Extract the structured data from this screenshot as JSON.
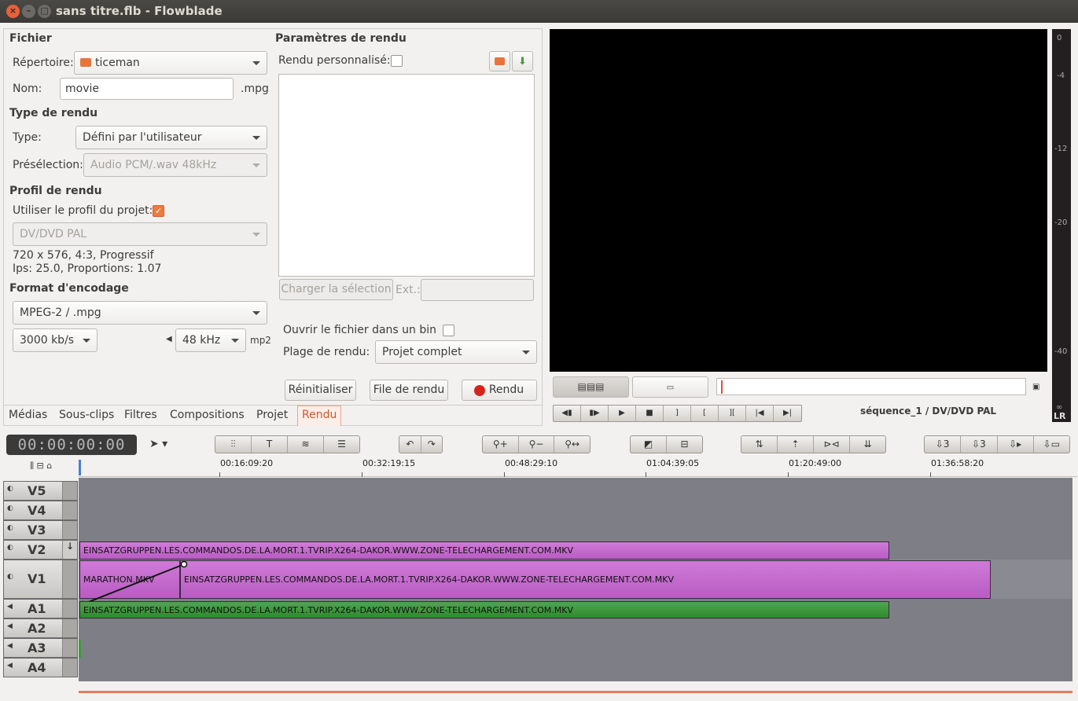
{
  "window": {
    "title": "sans titre.flb - Flowblade"
  },
  "file": {
    "heading": "Fichier",
    "dir_label": "Répertoire:",
    "dir_value": "ticeman",
    "name_label": "Nom:",
    "name_value": "movie",
    "ext": ".mpg"
  },
  "render_type": {
    "heading": "Type de rendu",
    "type_label": "Type:",
    "type_value": "Défini par l'utilisateur",
    "preset_label": "Présélection:",
    "preset_value": "Audio PCM/.wav 48kHz"
  },
  "profile": {
    "heading": "Profil de rendu",
    "use_project_label": "Utiliser le profil du projet:",
    "value": "DV/DVD PAL",
    "info1": "720 x 576, 4:3, Progressif",
    "info2": "Ips: 25.0, Proportions: 1.07"
  },
  "encoding": {
    "heading": "Format d'encodage",
    "format_value": "MPEG-2 / .mpg",
    "bitrate": "3000 kb/s",
    "audio_rate": "48 kHz",
    "audio_codec": "mp2"
  },
  "render_params": {
    "heading": "Paramètres de rendu",
    "custom_label": "Rendu personnalisé:",
    "load_selection": "Charger la sélection",
    "ext_label": "Ext.:",
    "open_in_bin": "Ouvrir le fichier dans un bin",
    "range_label": "Plage de rendu:",
    "range_value": "Projet complet",
    "reset": "Réinitialiser",
    "queue": "File de rendu",
    "render": "Rendu"
  },
  "tabs": [
    {
      "label": "Médias"
    },
    {
      "label": "Sous-clips"
    },
    {
      "label": "Filtres"
    },
    {
      "label": "Compositions"
    },
    {
      "label": "Projet"
    },
    {
      "label": "Rendu"
    }
  ],
  "viewer": {
    "sequence_info": "séquence_1 / DV/DVD PAL"
  },
  "meter": {
    "labels": [
      "0",
      "-4",
      "-12",
      "-20",
      "-40",
      "∞"
    ],
    "lr": "LR"
  },
  "timeline": {
    "timecode": "00:00:00:00",
    "ruler": [
      "00:16:09:20",
      "00:32:19:15",
      "00:48:29:10",
      "01:04:39:05",
      "01:20:49:00",
      "01:36:58:20"
    ],
    "tracks": [
      {
        "name": "V5"
      },
      {
        "name": "V4"
      },
      {
        "name": "V3"
      },
      {
        "name": "V2"
      },
      {
        "name": "V1"
      },
      {
        "name": "A1"
      },
      {
        "name": "A2"
      },
      {
        "name": "A3"
      },
      {
        "name": "A4"
      }
    ],
    "clips": {
      "v2": "EINSATZGRUPPEN.LES.COMMANDOS.DE.LA.MORT.1.TVRIP.X264-DAKOR.WWW.ZONE-TELECHARGEMENT.COM.MKV",
      "v1a": "MARATHON.MKV",
      "v1b": "EINSATZGRUPPEN.LES.COMMANDOS.DE.LA.MORT.1.TVRIP.X264-DAKOR.WWW.ZONE-TELECHARGEMENT.COM.MKV",
      "a1": "EINSATZGRUPPEN.LES.COMMANDOS.DE.LA.MORT.1.TVRIP.X264-DAKOR.WWW.ZONE-TELECHARGEMENT.COM.MKV"
    }
  }
}
